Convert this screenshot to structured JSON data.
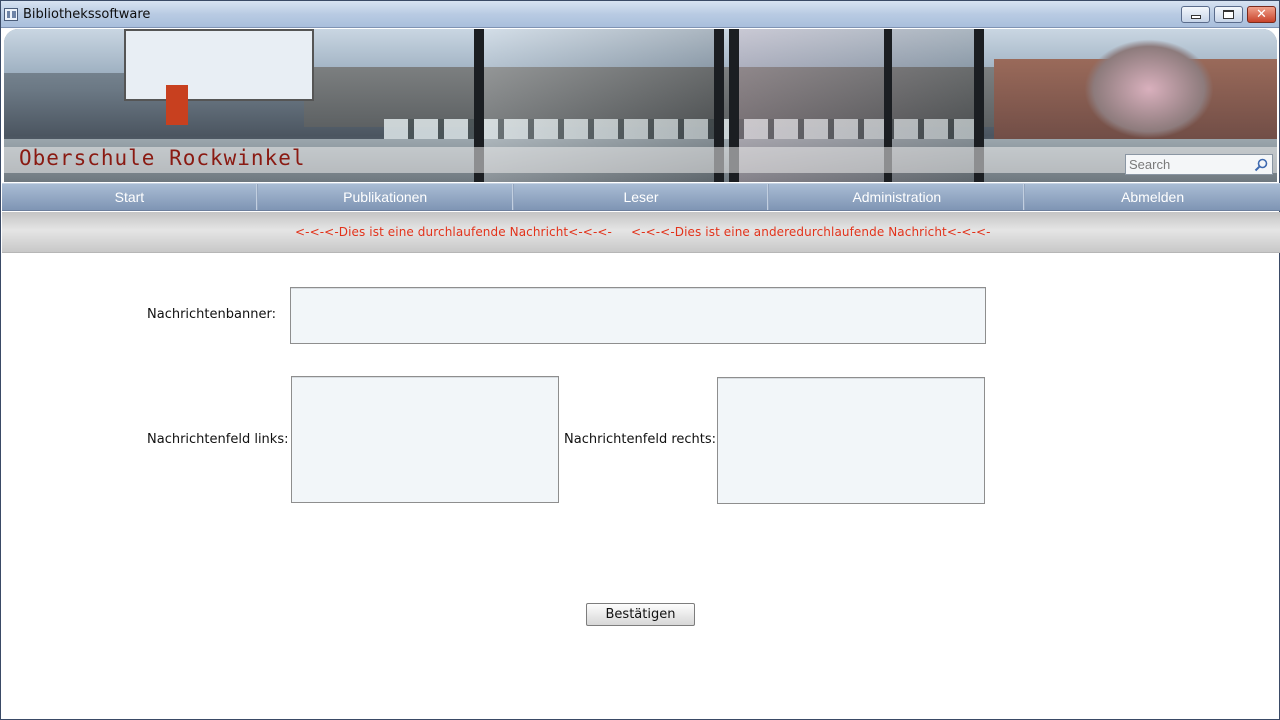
{
  "window": {
    "title": "Bibliothekssoftware",
    "icons": [
      "app-icon",
      "minimize-icon",
      "maximize-icon",
      "close-icon"
    ]
  },
  "banner": {
    "school_name": "Oberschule Rockwinkel",
    "search": {
      "placeholder": "Search",
      "value": "",
      "icon": "search-icon"
    },
    "colors": {
      "school_name": "#8a1a12"
    }
  },
  "nav": {
    "items": [
      {
        "label": "Start"
      },
      {
        "label": "Publikationen"
      },
      {
        "label": "Leser"
      },
      {
        "label": "Administration"
      },
      {
        "label": "Abmelden"
      }
    ]
  },
  "ticker": {
    "messages": [
      "<-<-<-Dies ist eine durchlaufende Nachricht<-<-<-",
      "<-<-<-Dies ist eine anderedurchlaufende Nachricht<-<-<-"
    ],
    "color": "#e2321a"
  },
  "form": {
    "banner_label": "Nachrichtenbanner:",
    "banner_value": "",
    "left_label": "Nachrichtenfeld links:",
    "left_value": "",
    "right_label": "Nachrichtenfeld rechts:",
    "right_value": "",
    "confirm_label": "Bestätigen"
  }
}
